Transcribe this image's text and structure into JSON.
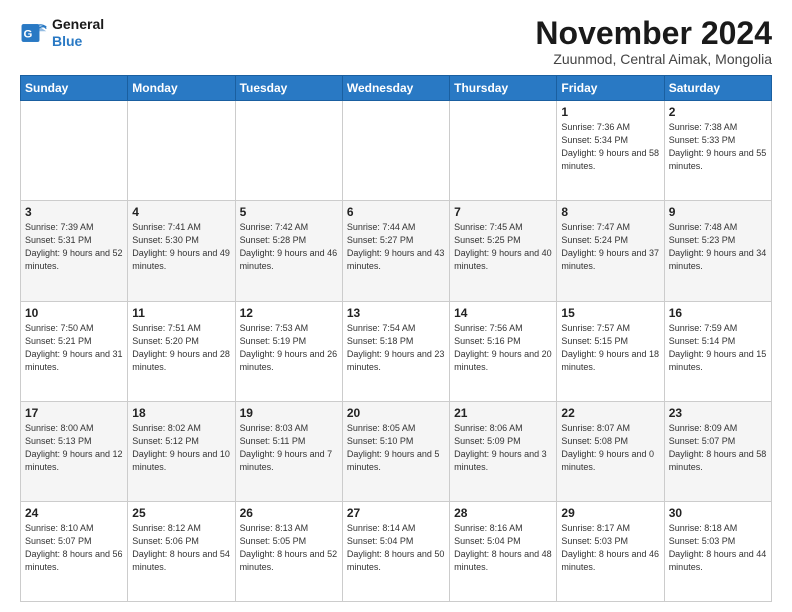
{
  "logo": {
    "line1": "General",
    "line2": "Blue"
  },
  "title": "November 2024",
  "subtitle": "Zuunmod, Central Aimak, Mongolia",
  "weekdays": [
    "Sunday",
    "Monday",
    "Tuesday",
    "Wednesday",
    "Thursday",
    "Friday",
    "Saturday"
  ],
  "weeks": [
    [
      {
        "day": "",
        "info": ""
      },
      {
        "day": "",
        "info": ""
      },
      {
        "day": "",
        "info": ""
      },
      {
        "day": "",
        "info": ""
      },
      {
        "day": "",
        "info": ""
      },
      {
        "day": "1",
        "info": "Sunrise: 7:36 AM\nSunset: 5:34 PM\nDaylight: 9 hours and 58 minutes."
      },
      {
        "day": "2",
        "info": "Sunrise: 7:38 AM\nSunset: 5:33 PM\nDaylight: 9 hours and 55 minutes."
      }
    ],
    [
      {
        "day": "3",
        "info": "Sunrise: 7:39 AM\nSunset: 5:31 PM\nDaylight: 9 hours and 52 minutes."
      },
      {
        "day": "4",
        "info": "Sunrise: 7:41 AM\nSunset: 5:30 PM\nDaylight: 9 hours and 49 minutes."
      },
      {
        "day": "5",
        "info": "Sunrise: 7:42 AM\nSunset: 5:28 PM\nDaylight: 9 hours and 46 minutes."
      },
      {
        "day": "6",
        "info": "Sunrise: 7:44 AM\nSunset: 5:27 PM\nDaylight: 9 hours and 43 minutes."
      },
      {
        "day": "7",
        "info": "Sunrise: 7:45 AM\nSunset: 5:25 PM\nDaylight: 9 hours and 40 minutes."
      },
      {
        "day": "8",
        "info": "Sunrise: 7:47 AM\nSunset: 5:24 PM\nDaylight: 9 hours and 37 minutes."
      },
      {
        "day": "9",
        "info": "Sunrise: 7:48 AM\nSunset: 5:23 PM\nDaylight: 9 hours and 34 minutes."
      }
    ],
    [
      {
        "day": "10",
        "info": "Sunrise: 7:50 AM\nSunset: 5:21 PM\nDaylight: 9 hours and 31 minutes."
      },
      {
        "day": "11",
        "info": "Sunrise: 7:51 AM\nSunset: 5:20 PM\nDaylight: 9 hours and 28 minutes."
      },
      {
        "day": "12",
        "info": "Sunrise: 7:53 AM\nSunset: 5:19 PM\nDaylight: 9 hours and 26 minutes."
      },
      {
        "day": "13",
        "info": "Sunrise: 7:54 AM\nSunset: 5:18 PM\nDaylight: 9 hours and 23 minutes."
      },
      {
        "day": "14",
        "info": "Sunrise: 7:56 AM\nSunset: 5:16 PM\nDaylight: 9 hours and 20 minutes."
      },
      {
        "day": "15",
        "info": "Sunrise: 7:57 AM\nSunset: 5:15 PM\nDaylight: 9 hours and 18 minutes."
      },
      {
        "day": "16",
        "info": "Sunrise: 7:59 AM\nSunset: 5:14 PM\nDaylight: 9 hours and 15 minutes."
      }
    ],
    [
      {
        "day": "17",
        "info": "Sunrise: 8:00 AM\nSunset: 5:13 PM\nDaylight: 9 hours and 12 minutes."
      },
      {
        "day": "18",
        "info": "Sunrise: 8:02 AM\nSunset: 5:12 PM\nDaylight: 9 hours and 10 minutes."
      },
      {
        "day": "19",
        "info": "Sunrise: 8:03 AM\nSunset: 5:11 PM\nDaylight: 9 hours and 7 minutes."
      },
      {
        "day": "20",
        "info": "Sunrise: 8:05 AM\nSunset: 5:10 PM\nDaylight: 9 hours and 5 minutes."
      },
      {
        "day": "21",
        "info": "Sunrise: 8:06 AM\nSunset: 5:09 PM\nDaylight: 9 hours and 3 minutes."
      },
      {
        "day": "22",
        "info": "Sunrise: 8:07 AM\nSunset: 5:08 PM\nDaylight: 9 hours and 0 minutes."
      },
      {
        "day": "23",
        "info": "Sunrise: 8:09 AM\nSunset: 5:07 PM\nDaylight: 8 hours and 58 minutes."
      }
    ],
    [
      {
        "day": "24",
        "info": "Sunrise: 8:10 AM\nSunset: 5:07 PM\nDaylight: 8 hours and 56 minutes."
      },
      {
        "day": "25",
        "info": "Sunrise: 8:12 AM\nSunset: 5:06 PM\nDaylight: 8 hours and 54 minutes."
      },
      {
        "day": "26",
        "info": "Sunrise: 8:13 AM\nSunset: 5:05 PM\nDaylight: 8 hours and 52 minutes."
      },
      {
        "day": "27",
        "info": "Sunrise: 8:14 AM\nSunset: 5:04 PM\nDaylight: 8 hours and 50 minutes."
      },
      {
        "day": "28",
        "info": "Sunrise: 8:16 AM\nSunset: 5:04 PM\nDaylight: 8 hours and 48 minutes."
      },
      {
        "day": "29",
        "info": "Sunrise: 8:17 AM\nSunset: 5:03 PM\nDaylight: 8 hours and 46 minutes."
      },
      {
        "day": "30",
        "info": "Sunrise: 8:18 AM\nSunset: 5:03 PM\nDaylight: 8 hours and 44 minutes."
      }
    ]
  ]
}
